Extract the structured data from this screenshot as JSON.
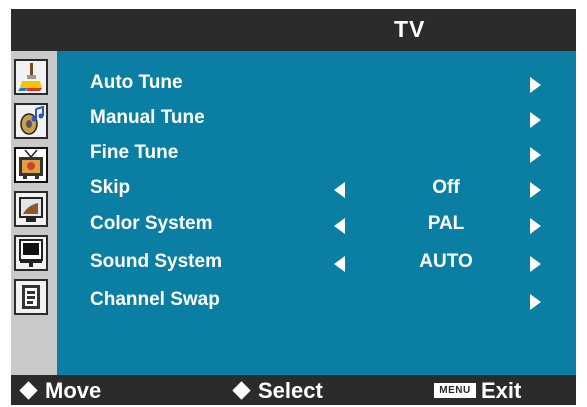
{
  "header": {
    "title": "TV"
  },
  "menu": {
    "items": [
      {
        "label": "Auto Tune",
        "value": "",
        "has_left": false,
        "has_right": true
      },
      {
        "label": "Manual Tune",
        "value": "",
        "has_left": false,
        "has_right": true
      },
      {
        "label": "Fine Tune",
        "value": "",
        "has_left": false,
        "has_right": true
      },
      {
        "label": "Skip",
        "value": "Off",
        "has_left": true,
        "has_right": true
      },
      {
        "label": "Color System",
        "value": "PAL",
        "has_left": true,
        "has_right": true
      },
      {
        "label": "Sound System",
        "value": "AUTO",
        "has_left": true,
        "has_right": true
      },
      {
        "label": "Channel Swap",
        "value": "",
        "has_left": false,
        "has_right": true
      }
    ]
  },
  "sidebar": {
    "icons": [
      {
        "name": "picture-brush-icon",
        "active": false
      },
      {
        "name": "audio-speaker-icon",
        "active": false
      },
      {
        "name": "tv-antenna-icon",
        "active": true
      },
      {
        "name": "screen-setup-icon",
        "active": false
      },
      {
        "name": "display-stand-icon",
        "active": false
      },
      {
        "name": "document-book-icon",
        "active": false
      }
    ]
  },
  "footer": {
    "move": "Move",
    "select": "Select",
    "menu_badge": "MENU",
    "exit": "Exit"
  },
  "colors": {
    "panel": "#0b7fa3",
    "bars": "#2b2b2b",
    "sidebar": "#c9c9c9",
    "text": "#ffffff"
  }
}
